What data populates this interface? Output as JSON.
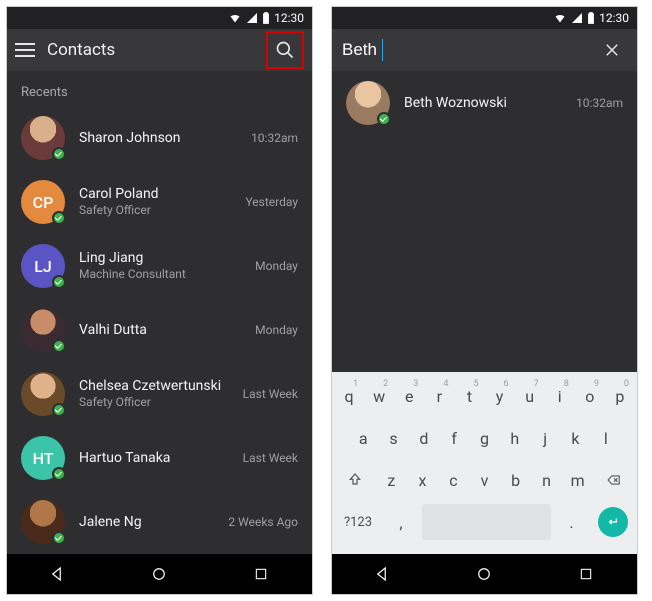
{
  "status": {
    "time": "12:30"
  },
  "left": {
    "title": "Contacts",
    "section": "Recents",
    "contacts": [
      {
        "name": "Sharon Johnson",
        "subtitle": "",
        "time": "10:32am",
        "avatar_type": "photo",
        "avatar_class": "av-photo-1",
        "initials": "",
        "color": ""
      },
      {
        "name": "Carol Poland",
        "subtitle": "Safety Officer",
        "time": "Yesterday",
        "avatar_type": "initials",
        "avatar_class": "",
        "initials": "CP",
        "color": "#e38a3f"
      },
      {
        "name": "Ling Jiang",
        "subtitle": "Machine Consultant",
        "time": "Monday",
        "avatar_type": "initials",
        "avatar_class": "",
        "initials": "LJ",
        "color": "#5b55c4"
      },
      {
        "name": "Valhi Dutta",
        "subtitle": "",
        "time": "Monday",
        "avatar_type": "photo",
        "avatar_class": "av-photo-2",
        "initials": "",
        "color": ""
      },
      {
        "name": "Chelsea Czetwertunski",
        "subtitle": "Safety Officer",
        "time": "Last Week",
        "avatar_type": "photo",
        "avatar_class": "av-photo-3",
        "initials": "",
        "color": ""
      },
      {
        "name": "Hartuo Tanaka",
        "subtitle": "",
        "time": "Last Week",
        "avatar_type": "initials",
        "avatar_class": "",
        "initials": "HT",
        "color": "#3bc4a8"
      },
      {
        "name": "Jalene Ng",
        "subtitle": "",
        "time": "2 Weeks Ago",
        "avatar_type": "photo",
        "avatar_class": "av-photo-5",
        "initials": "",
        "color": ""
      }
    ]
  },
  "right": {
    "search_value": "Beth",
    "results": [
      {
        "name": "Beth Woznowski",
        "time": "10:32am",
        "avatar_type": "photo",
        "avatar_class": "av-photo-4"
      }
    ]
  },
  "keyboard": {
    "row1": [
      "q",
      "w",
      "e",
      "r",
      "t",
      "y",
      "u",
      "i",
      "o",
      "p"
    ],
    "hints": [
      "1",
      "2",
      "3",
      "4",
      "5",
      "6",
      "7",
      "8",
      "9",
      "0"
    ],
    "row2": [
      "a",
      "s",
      "d",
      "f",
      "g",
      "h",
      "j",
      "k",
      "l"
    ],
    "row3": [
      "z",
      "x",
      "c",
      "v",
      "b",
      "n",
      "m"
    ],
    "sym": "?123",
    "comma": ",",
    "period": "."
  }
}
